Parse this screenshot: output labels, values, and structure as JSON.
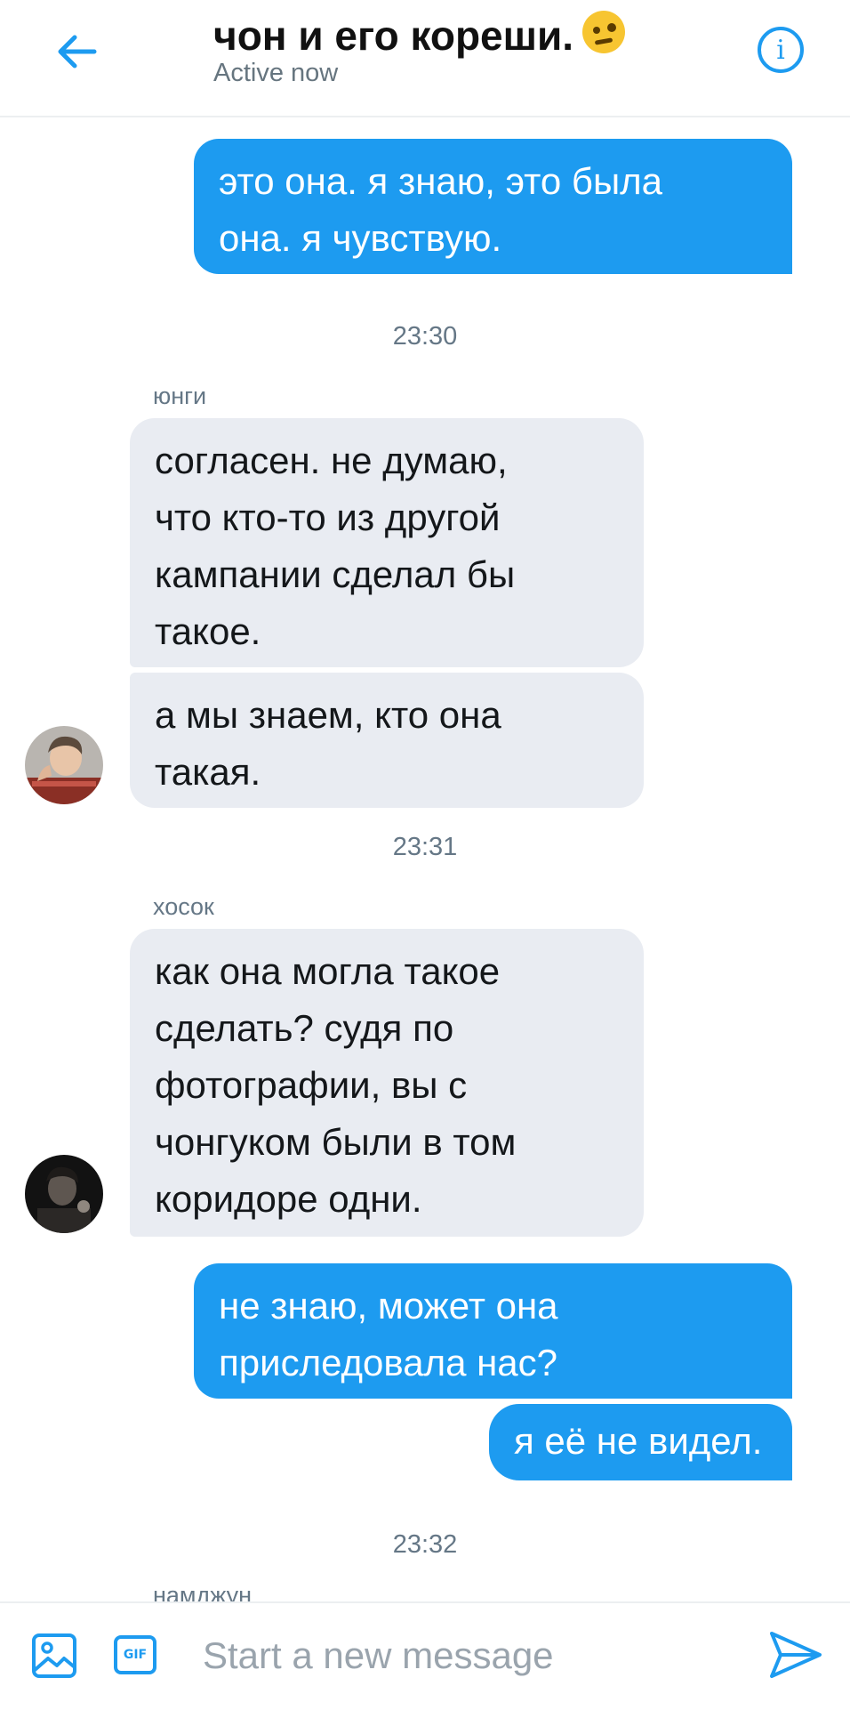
{
  "header": {
    "title": "чон и его кореши.",
    "status": "Active now"
  },
  "messages": [
    {
      "text": "это она. я знаю, это была\nона. я чувствую."
    },
    {
      "time": "23:30"
    },
    {
      "sender": "юнги"
    },
    {
      "text": "согласен. не думаю,\nчто кто-то из другой\nкампании сделал бы\nтакое."
    },
    {
      "text": "а мы знаем, кто она\nтакая."
    },
    {
      "time": "23:31"
    },
    {
      "sender": "хосок"
    },
    {
      "text": "как она могла такое\nсделать? судя по\nфотографии, вы с\nчонгуком были в том\nкоридоре одни."
    },
    {
      "text": "не знаю, может она\nприследовала нас?"
    },
    {
      "text": "я её не видел."
    },
    {
      "time": "23:32"
    },
    {
      "sender": "намджун"
    }
  ],
  "composer": {
    "placeholder": "Start a new message",
    "gif_label": "GIF"
  },
  "colors": {
    "accent": "#1d9bf0",
    "incoming_bubble": "#e9ecf2",
    "meta_text": "#657786"
  },
  "icons": [
    "back-arrow-icon",
    "info-icon",
    "image-icon",
    "gif-icon",
    "send-icon"
  ]
}
